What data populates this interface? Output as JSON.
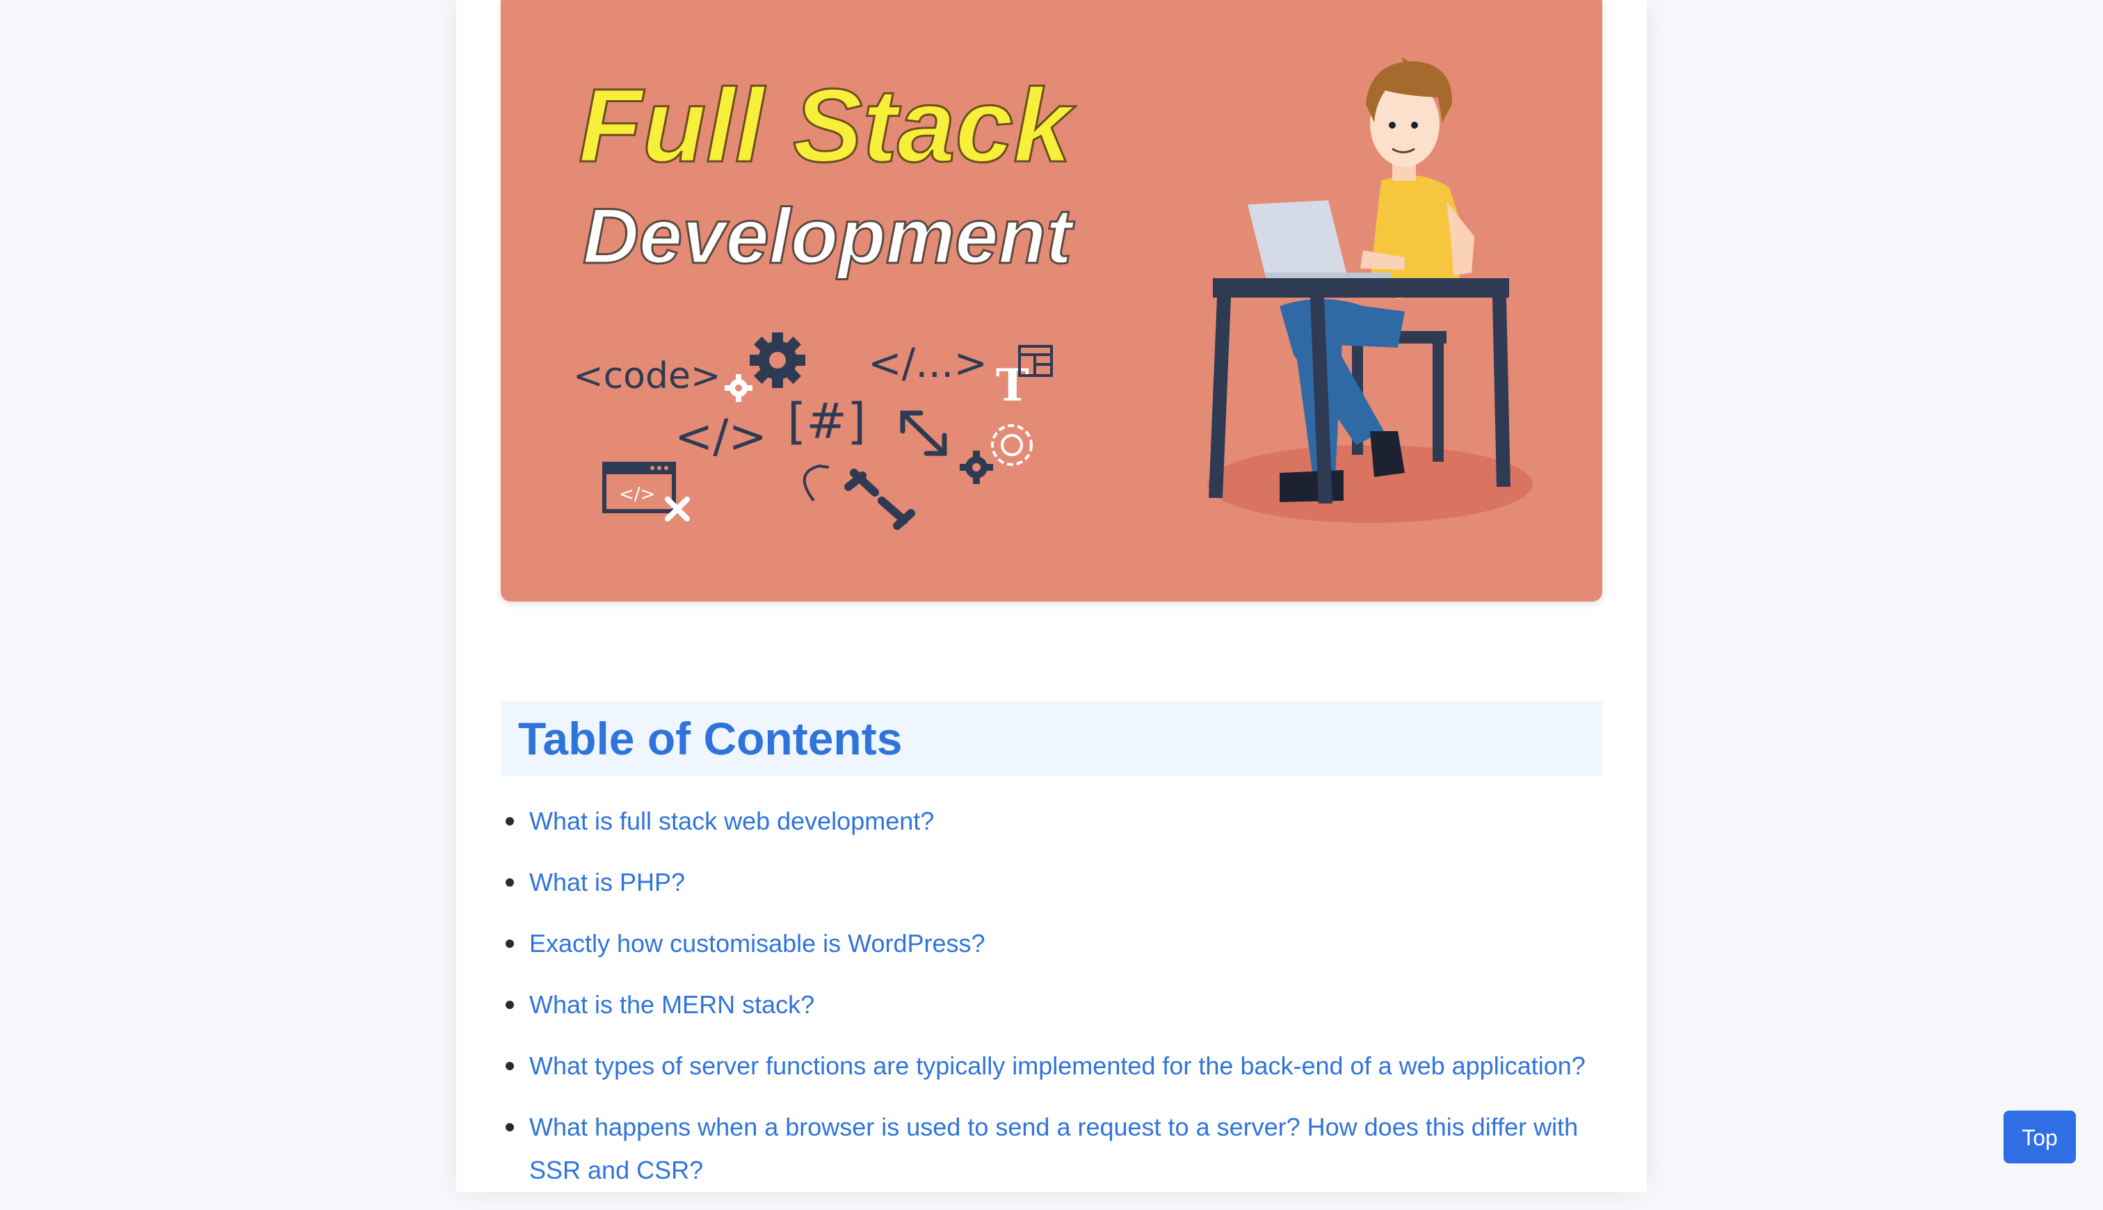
{
  "hero": {
    "title_line1": "Full Stack",
    "title_line2": "Development",
    "code_tag": "<code>",
    "close_tag": "</>",
    "ellipsis_tag": "</...>",
    "hash_tag": "[#]",
    "t_glyph": "T",
    "window_tag": "</>",
    "colors": {
      "background": "#e48b75",
      "title_yellow": "#f7ef3a",
      "title_white": "#ffffff",
      "icon_navy": "#2f3a53",
      "shirt": "#f6c73e",
      "jeans": "#2f6aa6"
    }
  },
  "toc": {
    "title": "Table of Contents",
    "items": [
      {
        "label": "What is full stack web development?"
      },
      {
        "label": "What is PHP?"
      },
      {
        "label": "Exactly how customisable is WordPress?"
      },
      {
        "label": "What is the MERN stack?"
      },
      {
        "label": "What types of server functions are typically implemented for the back-end of a web application?"
      },
      {
        "label": "What happens when a browser is used to send a request to a server? How does this differ with SSR and CSR?"
      }
    ]
  },
  "top_button": {
    "label": "Top"
  },
  "colors": {
    "link": "#2f74dc",
    "toc_header_bg": "#eff6fd",
    "button_bg": "#2f6ee4"
  }
}
